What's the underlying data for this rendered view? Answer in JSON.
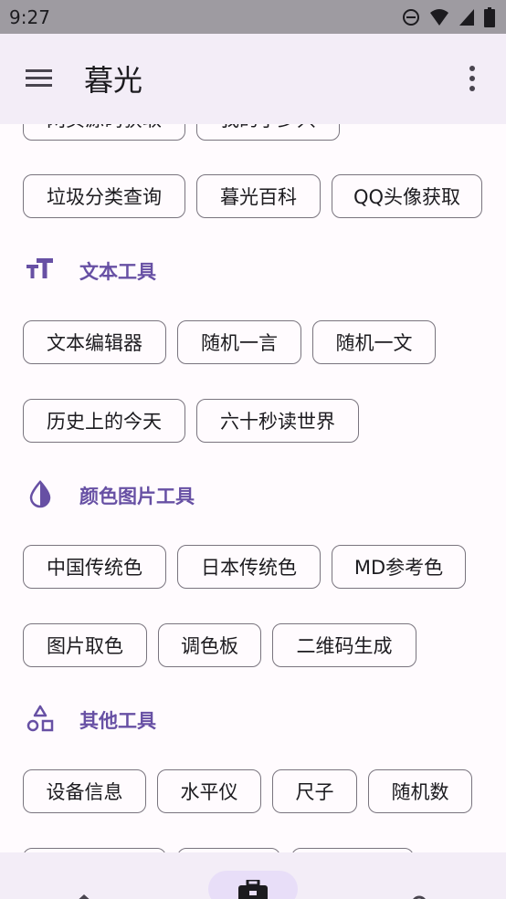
{
  "status_bar": {
    "time": "9:27",
    "icons": [
      "dnd-icon",
      "wifi-icon",
      "signal-icon",
      "battery-icon"
    ]
  },
  "app_bar": {
    "title": "暮光"
  },
  "sections": {
    "text_tools": {
      "title": "文本工具",
      "icon": "text-icon"
    },
    "color_image_tools": {
      "title": "颜色图片工具",
      "icon": "water-drop-icon"
    },
    "other_tools": {
      "title": "其他工具",
      "icon": "shapes-icon"
    }
  },
  "chips": {
    "cut_1": "网页源码获取",
    "cut_2": "我的手少只",
    "garbage": "垃圾分类查询",
    "baike": "暮光百科",
    "qq_avatar": "QQ头像获取",
    "text_editor": "文本编辑器",
    "random_quote": "随机一言",
    "random_article": "随机一文",
    "today_history": "历史上的今天",
    "sixty_seconds": "六十秒读世界",
    "china_colors": "中国传统色",
    "japan_colors": "日本传统色",
    "md_colors": "MD参考色",
    "color_picker": "图片取色",
    "palette": "调色板",
    "qrcode": "二维码生成",
    "device_info": "设备信息",
    "level": "水平仪",
    "ruler": "尺子",
    "random_number": "随机数"
  },
  "colors": {
    "accent": "#6750a4",
    "app_bar": "#f3edf7",
    "background": "#fffbfe",
    "nav_pill": "#e8def8"
  },
  "bottom_nav": {
    "icons": [
      "home-icon",
      "toolbox-icon",
      "person-icon"
    ],
    "selected": "toolbox-icon"
  }
}
